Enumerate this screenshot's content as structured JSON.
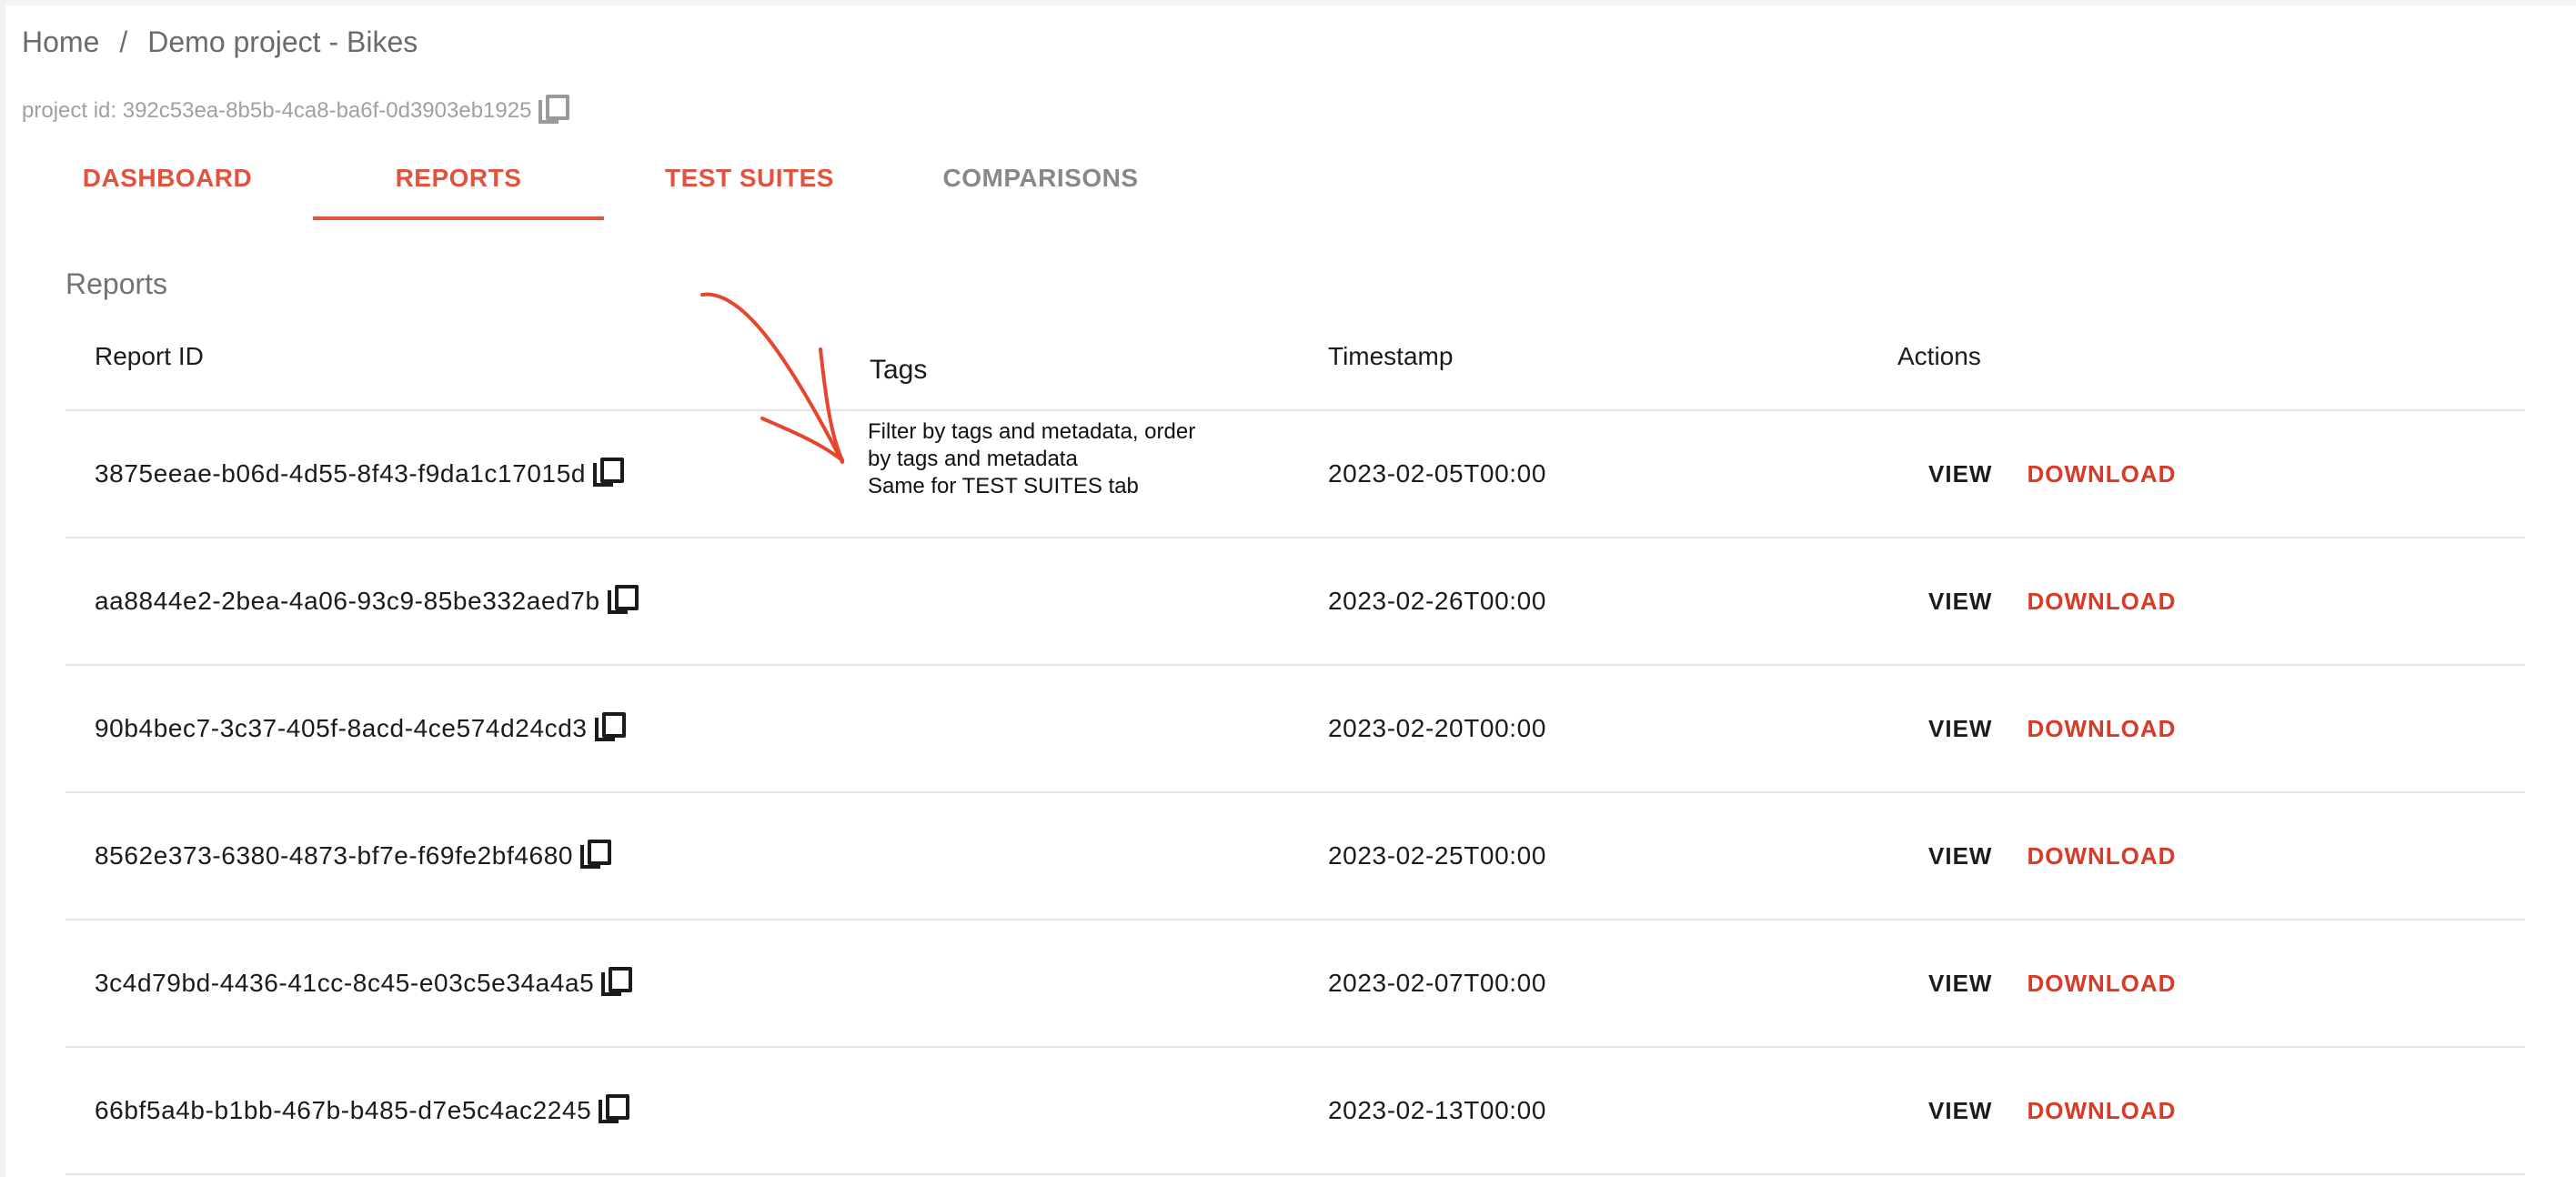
{
  "breadcrumb": {
    "home": "Home",
    "separator": "/",
    "current": "Demo project - Bikes"
  },
  "project": {
    "id_label": "project id: 392c53ea-8b5b-4ca8-ba6f-0d3903eb1925",
    "copy_icon": "copy-icon"
  },
  "tabs": [
    {
      "label": "DASHBOARD",
      "active": false
    },
    {
      "label": "REPORTS",
      "active": true
    },
    {
      "label": "TEST SUITES",
      "active": false
    },
    {
      "label": "COMPARISONS",
      "active": false
    }
  ],
  "reports": {
    "title": "Reports",
    "columns": {
      "id": "Report ID",
      "tags": "Tags",
      "timestamp": "Timestamp",
      "actions": "Actions"
    },
    "rows": [
      {
        "id": "3875eeae-b06d-4d55-8f43-f9da1c17015d",
        "timestamp": "2023-02-05T00:00",
        "view": "VIEW",
        "download": "DOWNLOAD"
      },
      {
        "id": "aa8844e2-2bea-4a06-93c9-85be332aed7b",
        "timestamp": "2023-02-26T00:00",
        "view": "VIEW",
        "download": "DOWNLOAD"
      },
      {
        "id": "90b4bec7-3c37-405f-8acd-4ce574d24cd3",
        "timestamp": "2023-02-20T00:00",
        "view": "VIEW",
        "download": "DOWNLOAD"
      },
      {
        "id": "8562e373-6380-4873-bf7e-f69fe2bf4680",
        "timestamp": "2023-02-25T00:00",
        "view": "VIEW",
        "download": "DOWNLOAD"
      },
      {
        "id": "3c4d79bd-4436-41cc-8c45-e03c5e34a4a5",
        "timestamp": "2023-02-07T00:00",
        "view": "VIEW",
        "download": "DOWNLOAD"
      },
      {
        "id": "66bf5a4b-b1bb-467b-b485-d7e5c4ac2245",
        "timestamp": "2023-02-13T00:00",
        "view": "VIEW",
        "download": "DOWNLOAD"
      }
    ]
  },
  "annotation": {
    "line1": "Filter by tags and metadata, order",
    "line2": "by tags and metadata",
    "line3": "Same for TEST SUITES tab",
    "arrow_color": "#e8452f"
  },
  "colors": {
    "accent": "#e0533f",
    "download": "#d93a28",
    "inactive_tab": "#888888"
  }
}
